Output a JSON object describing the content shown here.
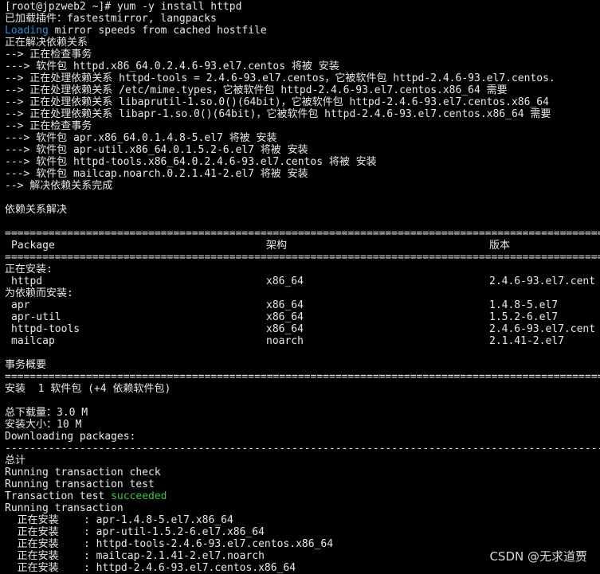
{
  "terminal": {
    "prompt": "[root@jpzweb2 ~]# yum -y install httpd",
    "plugins": "已加载插件：fastestmirror, langpacks",
    "loading_word": "Loading",
    "loading_rest": " mirror speeds from cached hostfile",
    "deps": [
      "正在解决依赖关系",
      "--> 正在检查事务",
      "---> 软件包 httpd.x86_64.0.2.4.6-93.el7.centos 将被 安装",
      "--> 正在处理依赖关系 httpd-tools = 2.4.6-93.el7.centos，它被软件包 httpd-2.4.6-93.el7.centos.",
      "--> 正在处理依赖关系 /etc/mime.types，它被软件包 httpd-2.4.6-93.el7.centos.x86_64 需要",
      "--> 正在处理依赖关系 libaprutil-1.so.0()(64bit)，它被软件包 httpd-2.4.6-93.el7.centos.x86_64",
      "--> 正在处理依赖关系 libapr-1.so.0()(64bit)，它被软件包 httpd-2.4.6-93.el7.centos.x86_64 需要",
      "--> 正在检查事务",
      "---> 软件包 apr.x86_64.0.1.4.8-5.el7 将被 安装",
      "---> 软件包 apr-util.x86_64.0.1.5.2-6.el7 将被 安装",
      "---> 软件包 httpd-tools.x86_64.0.2.4.6-93.el7.centos 将被 安装",
      "---> 软件包 mailcap.noarch.0.2.1.41-2.el7 将被 安装",
      "--> 解决依赖关系完成"
    ],
    "resolved": "依赖关系解决",
    "separator_double": "==================================================================================================",
    "separator_single": "--------------------------------------------------------------------------------------------------",
    "table_header": {
      "package": "Package",
      "arch": "架构",
      "version": "版本"
    },
    "installing_label": "正在安装:",
    "installing": [
      {
        "package": "httpd",
        "arch": "x86_64",
        "version": "2.4.6-93.el7.cent"
      }
    ],
    "dep_installing_label": "为依赖而安装:",
    "dep_installing": [
      {
        "package": "apr",
        "arch": "x86_64",
        "version": "1.4.8-5.el7"
      },
      {
        "package": "apr-util",
        "arch": "x86_64",
        "version": "1.5.2-6.el7"
      },
      {
        "package": "httpd-tools",
        "arch": "x86_64",
        "version": "2.4.6-93.el7.cent"
      },
      {
        "package": "mailcap",
        "arch": "noarch",
        "version": "2.1.41-2.el7"
      }
    ],
    "summary_title": "事务概要",
    "summary_install": "安装  1 软件包 (+4 依赖软件包)",
    "total_download": "总下载量：3.0 M",
    "installed_size": "安装大小：10 M",
    "downloading": "Downloading packages:",
    "total": "总计",
    "check": "Running transaction check",
    "test": "Running transaction test",
    "test_result_prefix": "Transaction test ",
    "test_result_word": "succeeded",
    "running": "Running transaction",
    "steps": [
      "  正在安装    : apr-1.4.8-5.el7.x86_64",
      "  正在安装    : apr-util-1.5.2-6.el7.x86_64",
      "  正在安装    : httpd-tools-2.4.6-93.el7.centos.x86_64",
      "  正在安装    : mailcap-2.1.41-2.el7.noarch",
      "  正在安装    : httpd-2.4.6-93.el7.centos.x86_64"
    ],
    "colors": {
      "info": "#2b8fd6",
      "success": "#3fc33f",
      "text": "#e8e8e8",
      "background": "#000000"
    }
  },
  "watermark": "CSDN @无求道贾"
}
